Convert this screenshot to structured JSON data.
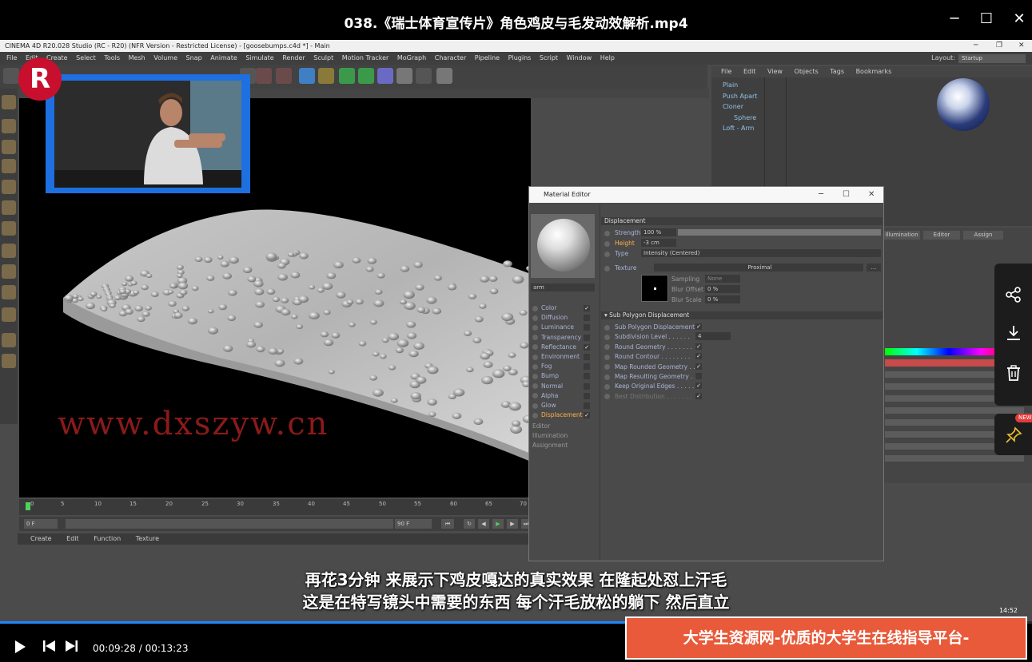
{
  "player": {
    "title": "038.《瑞士体育宣传片》角色鸡皮与毛发动效解析.mp4",
    "current_time": "00:09:28",
    "separator": " / ",
    "total_time": "00:13:23",
    "progress_fraction": 0.707
  },
  "c4d": {
    "window_title": "CINEMA 4D R20.028 Studio (RC - R20) (NFR Version - Restricted License) - [goosebumps.c4d *] - Main",
    "menu": [
      "File",
      "Edit",
      "Create",
      "Select",
      "Tools",
      "Mesh",
      "Volume",
      "Snap",
      "Animate",
      "Simulate",
      "Render",
      "Sculpt",
      "Motion Tracker",
      "MoGraph",
      "Character",
      "Pipeline",
      "Plugins",
      "Script",
      "Window",
      "Help"
    ],
    "layout_label": "Layout:",
    "layout_value": "Startup",
    "watermark": "www.dxszyw.cn",
    "timeline_ticks": [
      "0",
      "5",
      "10",
      "15",
      "20",
      "25",
      "30",
      "35",
      "40",
      "45",
      "50",
      "55",
      "60",
      "65",
      "70"
    ],
    "frame_start": "0 F",
    "frame_end": "90 F",
    "frame_end2": "90 F",
    "material_menu": [
      "Create",
      "Edit",
      "Function",
      "Texture"
    ]
  },
  "object_manager": {
    "menu": [
      "File",
      "Edit",
      "View",
      "Objects",
      "Tags",
      "Bookmarks"
    ],
    "objects": [
      "Plain",
      "Push Apart",
      "Cloner",
      "Sphere",
      "Loft - Arm"
    ]
  },
  "attributes": {
    "tabs": [
      "Illumination",
      "Editor",
      "Assign"
    ]
  },
  "material_editor": {
    "title": "Material Editor",
    "material_name": "arm",
    "channels": [
      {
        "label": "Color",
        "checked": true
      },
      {
        "label": "Diffusion",
        "checked": false
      },
      {
        "label": "Luminance",
        "checked": false
      },
      {
        "label": "Transparency",
        "checked": false
      },
      {
        "label": "Reflectance",
        "checked": true
      },
      {
        "label": "Environment",
        "checked": false
      },
      {
        "label": "Fog",
        "checked": false
      },
      {
        "label": "Bump",
        "checked": false
      },
      {
        "label": "Normal",
        "checked": false
      },
      {
        "label": "Alpha",
        "checked": false
      },
      {
        "label": "Glow",
        "checked": false
      },
      {
        "label": "Displacement",
        "checked": true
      }
    ],
    "extra_items": [
      "Editor",
      "Illumination",
      "Assignment"
    ],
    "section_displacement": "Displacement",
    "strength_label": "Strength",
    "strength_value": "100 %",
    "height_label": "Height",
    "height_value": "-3 cm",
    "type_label": "Type",
    "type_value": "Intensity (Centered)",
    "texture_label": "Texture",
    "texture_value": "Proximal",
    "sampling_label": "Sampling",
    "sampling_value": "None",
    "blur_offset_label": "Blur Offset",
    "blur_offset_value": "0 %",
    "blur_scale_label": "Blur Scale",
    "blur_scale_value": "0 %",
    "section_subpoly": "Sub Polygon Displacement",
    "subpoly_rows": [
      {
        "label": "Sub Polygon Displacement",
        "value": "✓"
      },
      {
        "label": "Subdivision Level . . . . . .",
        "value": "4"
      },
      {
        "label": "Round Geometry . . . . . . .",
        "value": "✓"
      },
      {
        "label": "Round Contour . . . . . . . .",
        "value": "✓"
      },
      {
        "label": "Map Rounded Geometry . .",
        "value": "✓"
      },
      {
        "label": "Map Resulting Geometry . .",
        "value": ""
      },
      {
        "label": "Keep Original Edges . . . . .",
        "value": "✓"
      },
      {
        "label": "Best Distribution . . . . . . .",
        "value": "✓"
      }
    ]
  },
  "subtitles": [
    "再花3分钟 来展示下鸡皮嘎达的真实效果 在隆起处怼上汗毛",
    "这是在特写镜头中需要的东西 每个汗毛放松的躺下 然后直立"
  ],
  "side_panel": {
    "new_badge": "NEW"
  },
  "taskbar": {
    "time": "14:52"
  },
  "banner": "大学生资源网-优质的大学生在线指导平台-www.dxszyw.cn",
  "pip_logo": "R"
}
